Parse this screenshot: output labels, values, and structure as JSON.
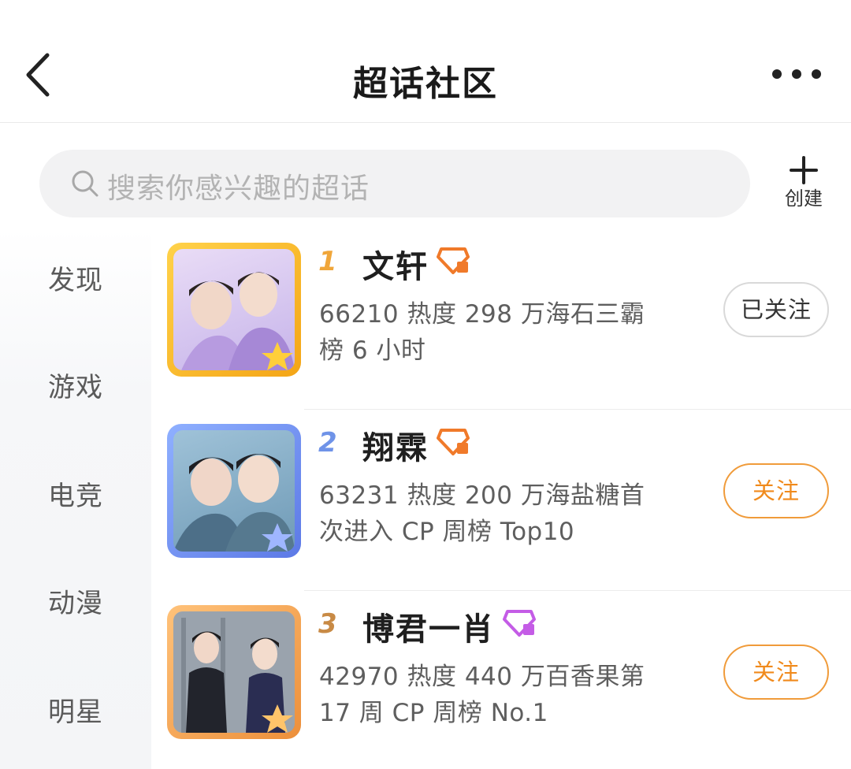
{
  "header": {
    "title": "超话社区"
  },
  "search": {
    "placeholder": "搜索你感兴趣的超话",
    "create_label": "创建"
  },
  "sidebar": {
    "items": [
      {
        "label": "发现"
      },
      {
        "label": "游戏"
      },
      {
        "label": "电竞"
      },
      {
        "label": "动漫"
      },
      {
        "label": "明星"
      }
    ]
  },
  "list": {
    "items": [
      {
        "rank": "1",
        "name": "文轩",
        "stats": "66210 热度 298 万海石三霸榜 6 小时",
        "button": "已关注",
        "badge_color": "#f07a2a",
        "frame_color": "#f6b321"
      },
      {
        "rank": "2",
        "name": "翔霖",
        "stats": "63231 热度 200 万海盐糖首次进入 CP 周榜 Top10",
        "button": "关注",
        "badge_color": "#f07a2a",
        "frame_color": "#6b8cf0"
      },
      {
        "rank": "3",
        "name": "博君一肖",
        "stats": "42970 热度 440 万百香果第 17 周 CP 周榜 No.1",
        "button": "关注",
        "badge_color": "#c45ce6",
        "frame_color": "#f0a040"
      }
    ]
  }
}
